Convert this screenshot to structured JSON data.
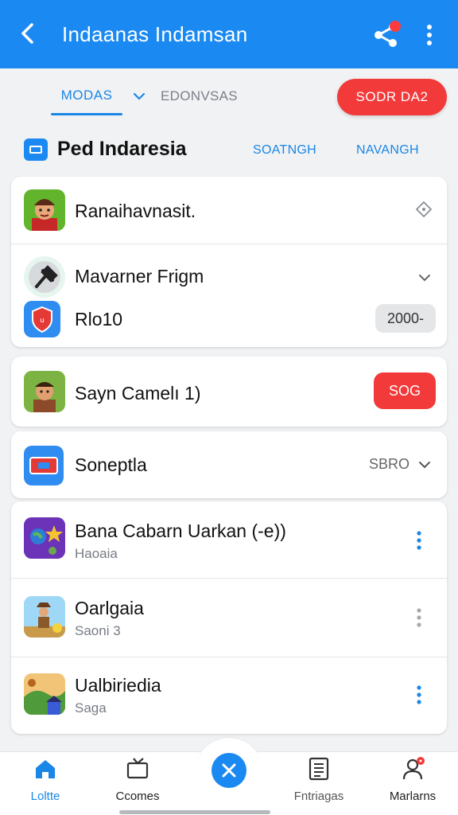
{
  "app_bar": {
    "title": "Indaanas Indamsan",
    "back_icon": "arrow-back-icon",
    "share_icon": "share-icon",
    "more_icon": "more-vert-icon",
    "background": "#1a8af2"
  },
  "tabs": {
    "active_label": "MODAS",
    "second_label": "EDONVSAS",
    "action_button": "SODR DA2"
  },
  "section": {
    "title": "Ped Indaresia",
    "link_1": "SOATNGH",
    "link_2": "NAVANGH"
  },
  "list": {
    "group_1": [
      {
        "title": "Ranaihavnasit.",
        "trailing_icon": "location-icon"
      },
      {
        "title": "Mavarner Frigm",
        "trailing_icon": "chevron-down-icon"
      },
      {
        "title": "Rlo10",
        "value": "2000-"
      }
    ],
    "group_2": {
      "title": "Sayn Camelı 1)",
      "button": "SOG"
    },
    "group_3": {
      "title": "Soneptla",
      "value": "SBRO"
    },
    "group_4": [
      {
        "title": "Bana Cabarn Uarkan (-e))",
        "subtitle": "Haoaia"
      },
      {
        "title": "Oarlgaia",
        "subtitle": "Saoni 3"
      },
      {
        "title": "Ualbiriedia",
        "subtitle": "Saga"
      }
    ]
  },
  "bottom_nav": {
    "items": [
      {
        "label": "Loltte",
        "icon": "home-icon",
        "active": true
      },
      {
        "label": "Ccomes",
        "icon": "tv-icon",
        "active": false
      },
      {
        "label": "Fntriagas",
        "icon": "document-icon",
        "active": false
      },
      {
        "label": "Marlarns",
        "icon": "profile-icon",
        "active": false
      }
    ],
    "fab_icon": "close-icon"
  },
  "colors": {
    "accent": "#1a8af2",
    "danger": "#f23a3a",
    "background": "#f1f2f4"
  }
}
